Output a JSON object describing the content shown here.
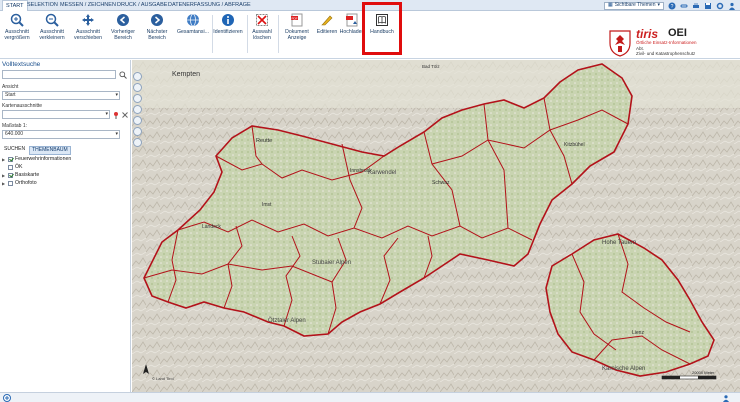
{
  "menu": {
    "tabs": [
      "START",
      "SELEKTION",
      "MESSEN / ZEICHNEN",
      "DRUCK / AUSGABE",
      "DATENERFASSUNG / ABFRAGE"
    ],
    "theme_select": "Sichtbare Themen"
  },
  "ribbon": {
    "zoom_in": "Ausschnitt\nvergrößern",
    "zoom_out": "Ausschnitt\nverkleinern",
    "pan": "Ausschnitt\nverschieben",
    "prev": "Vorheriger\nBereich",
    "next": "Nächster\nBereich",
    "full": "Gesamtansi...",
    "identify": "Identifizieren",
    "clear": "Auswahl\nlöschen",
    "doc": "Dokument\nAnzeige",
    "edit": "Editieren",
    "upload": "Hochladen",
    "manual": "Handbuch"
  },
  "logo": {
    "brand": "tiris",
    "brand2": "OEI",
    "sub1": "Örtliche Einsatz-Informationen",
    "sub2": "Abt.",
    "sub3": "Zivil- und Katastrophenschutz"
  },
  "sidebar": {
    "fulltext_title": "Volltextsuche",
    "view_label": "Ansicht",
    "view_value": "Start",
    "extracts_label": "Kartenausschnitte",
    "scale_label": "Maßstab 1:",
    "scale_value": "640.000",
    "tab_search": "SUCHEN",
    "tab_tree": "THEMENBAUM",
    "tree": [
      "Feuerwehrinformationen",
      "ÖK",
      "Basiskarte",
      "Orthofoto"
    ]
  },
  "map": {
    "labels": {
      "kempten": "Kempten",
      "bad_tolz": "Bad Tölz",
      "reutte": "Reutte",
      "innsbruck": "Innsbruck",
      "karwendel": "Karwendel",
      "kitzbuhel": "Kitzbühel",
      "landeck": "Landeck",
      "imst": "Imst",
      "schwaz": "Schwaz",
      "stubaier": "Stubaier Alpen",
      "otztaler": "Ötztaler Alpen",
      "lienz": "Lienz",
      "hohe_tauern": "Hohe Tauern",
      "karnische": "Karnische Alpen"
    },
    "scale_text": "20000 Meter",
    "attribution": "© Land Tirol"
  },
  "colors": {
    "border": "#b3121a",
    "accent": "#1a4f8c"
  }
}
